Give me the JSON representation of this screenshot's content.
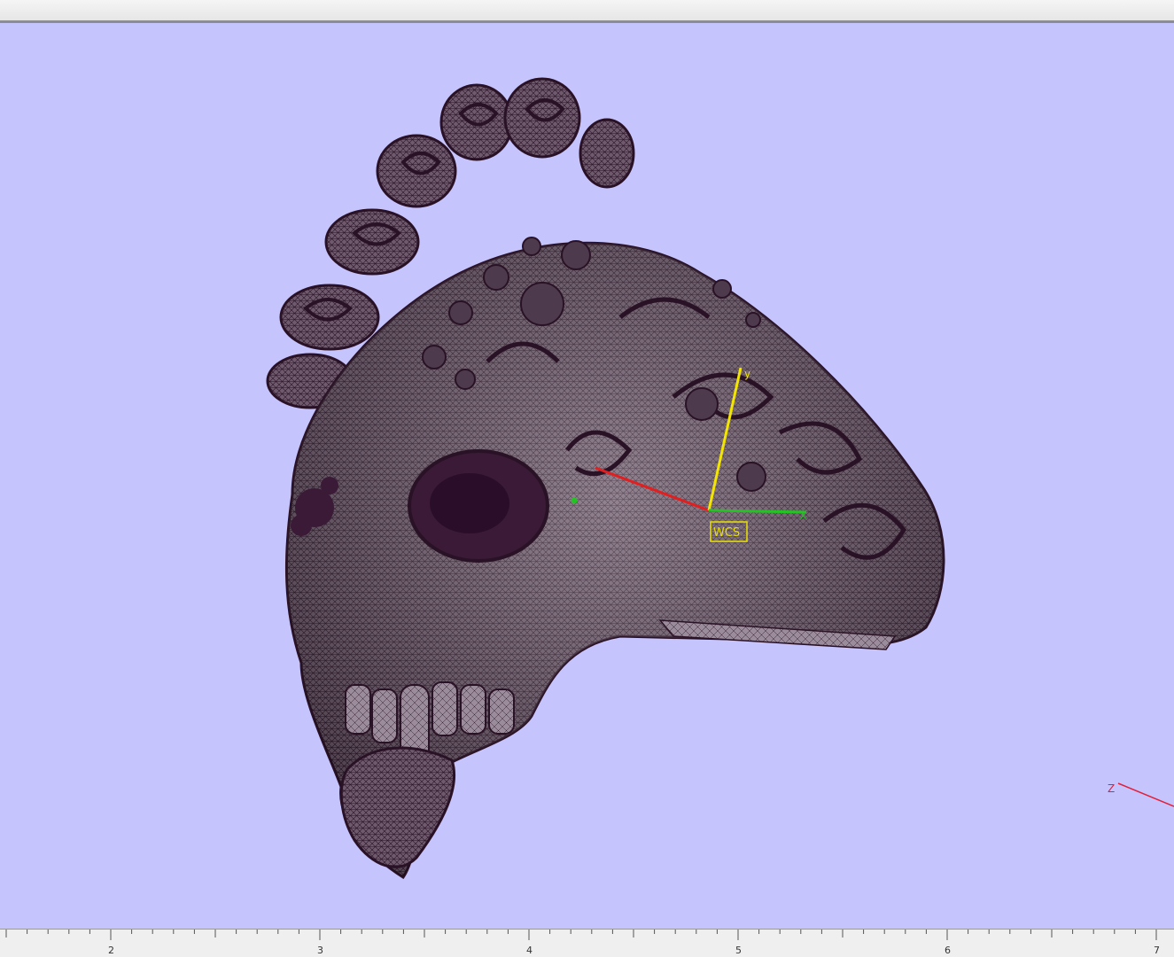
{
  "viewport": {
    "background_color": "#c6c4fd",
    "model": {
      "name_icon": "skull-mesh-model",
      "mesh_color": "#5a4658",
      "wire_color": "#2a1226"
    },
    "gizmo": {
      "label": "WCS",
      "x_axis_label": "x",
      "y_axis_label": "y",
      "x_color": "#22c422",
      "y_color": "#f2e600",
      "z_color": "#e02020"
    },
    "corner_axis": {
      "label": "Z",
      "color": "#e0203a"
    }
  },
  "ruler": {
    "labels": [
      "2",
      "3",
      "4",
      "5",
      "6",
      "7"
    ]
  }
}
